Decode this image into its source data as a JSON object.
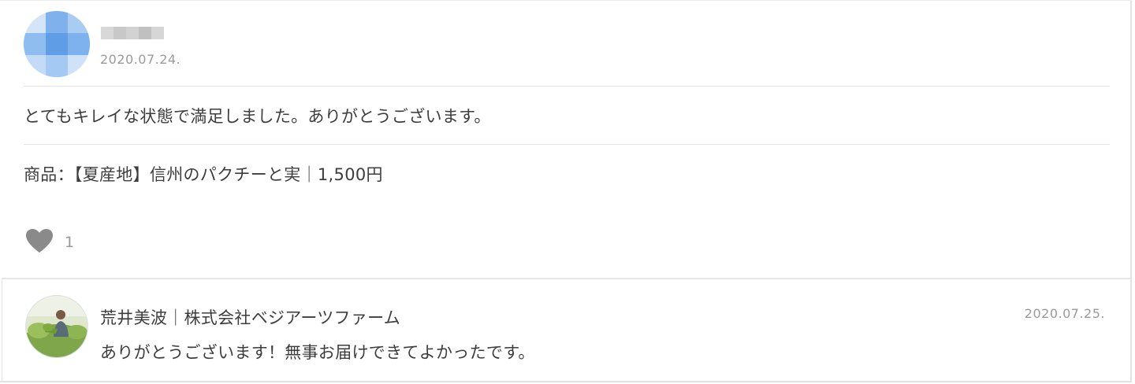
{
  "review": {
    "date": "2020.07.24.",
    "text": "とてもキレイな状態で満足しました。ありがとうございます。",
    "product": "商品：【夏産地】信州のパクチーと実｜1,500円",
    "like_icon": "heart-icon",
    "like_count": "1"
  },
  "reply": {
    "author": "荒井美波｜株式会社ベジアーツファーム",
    "date": "2020.07.25.",
    "text": "ありがとうございます！無事お届けできてよかったです。"
  },
  "colors": {
    "avatar_blur": "#8fbdf0",
    "heart": "#8a8a8a",
    "muted_text": "#9a9a9a",
    "body_text": "#3d3d3d",
    "divider": "#e3e3e3"
  }
}
